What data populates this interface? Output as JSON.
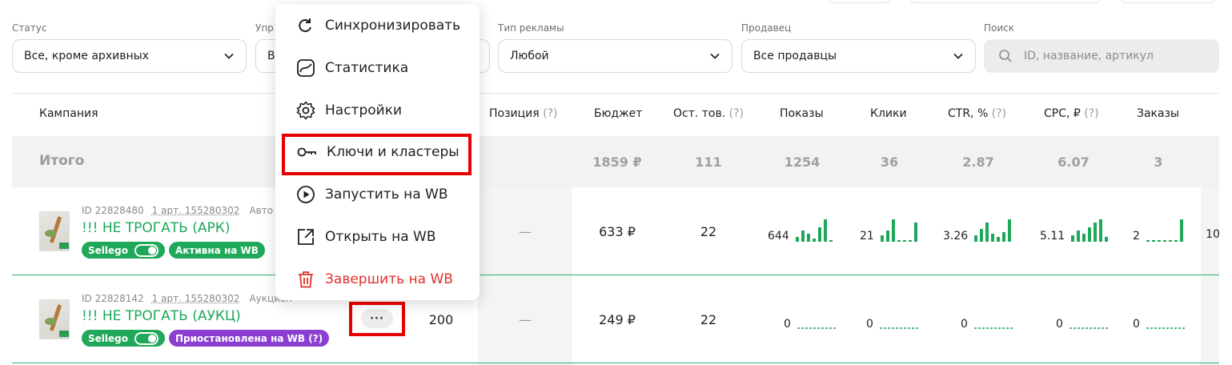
{
  "filters": {
    "status": {
      "label": "Статус",
      "value": "Все, кроме архивных"
    },
    "management": {
      "label": "Упр",
      "value": "В"
    },
    "ad_type": {
      "label": "Тип рекламы",
      "value": "Любой"
    },
    "seller": {
      "label": "Продавец",
      "value": "Все продавцы"
    },
    "search": {
      "label": "Поиск",
      "placeholder": "ID, название, артикул"
    }
  },
  "table": {
    "headers": {
      "campaign": "Кампания",
      "position": "Позиция",
      "budget": "Бюджет",
      "stock": "Ост. тов.",
      "impressions": "Показы",
      "clicks": "Клики",
      "ctr": "CTR, %",
      "cpc": "CPC, ₽",
      "orders": "Заказы",
      "help_mark": "(?)"
    },
    "total": {
      "label": "Итого",
      "budget": "1859 ₽",
      "stock": "111",
      "impressions": "1254",
      "clicks": "36",
      "ctr": "2.87",
      "cpc": "6.07",
      "orders": "3"
    },
    "rows": [
      {
        "id": "ID 22828480",
        "article": "1 арт. 155280302",
        "type": "Авто",
        "name": "!!! НЕ ТРОГАТЬ (АРК)",
        "sellego": "Sellego",
        "status": "Активна на WB",
        "position": "—",
        "budget": "633 ₽",
        "stock": "22",
        "impressions": "644",
        "clicks": "21",
        "ctr": "3.26",
        "cpc": "5.11",
        "orders": "2",
        "next_col": "10"
      },
      {
        "id": "ID 22828142",
        "article": "1 арт. 155280302",
        "type": "Аукцион",
        "name": "!!! НЕ ТРОГАТЬ (АУКЦ)",
        "sellego": "Sellego",
        "status": "Приостановлена на WB (?)",
        "bid": "200",
        "more": "···",
        "position": "—",
        "budget": "249 ₽",
        "stock": "22",
        "impressions": "0",
        "clicks": "0",
        "ctr": "0",
        "cpc": "0",
        "orders": "0"
      }
    ]
  },
  "context_menu": {
    "items": [
      {
        "label": "Синхронизировать",
        "icon": "refresh-icon"
      },
      {
        "label": "Статистика",
        "icon": "chart-icon"
      },
      {
        "label": "Настройки",
        "icon": "gear-icon"
      },
      {
        "label": "Ключи и кластеры",
        "icon": "key-icon"
      },
      {
        "label": "Запустить на WB",
        "icon": "play-icon"
      },
      {
        "label": "Открыть на WB",
        "icon": "external-link-icon"
      },
      {
        "label": "Завершить на WB",
        "icon": "trash-icon"
      }
    ]
  },
  "colors": {
    "accent_green": "#1fa85a",
    "paused_purple": "#8b3fd0",
    "danger_red": "#e0302b",
    "highlight_red": "#e60000"
  }
}
